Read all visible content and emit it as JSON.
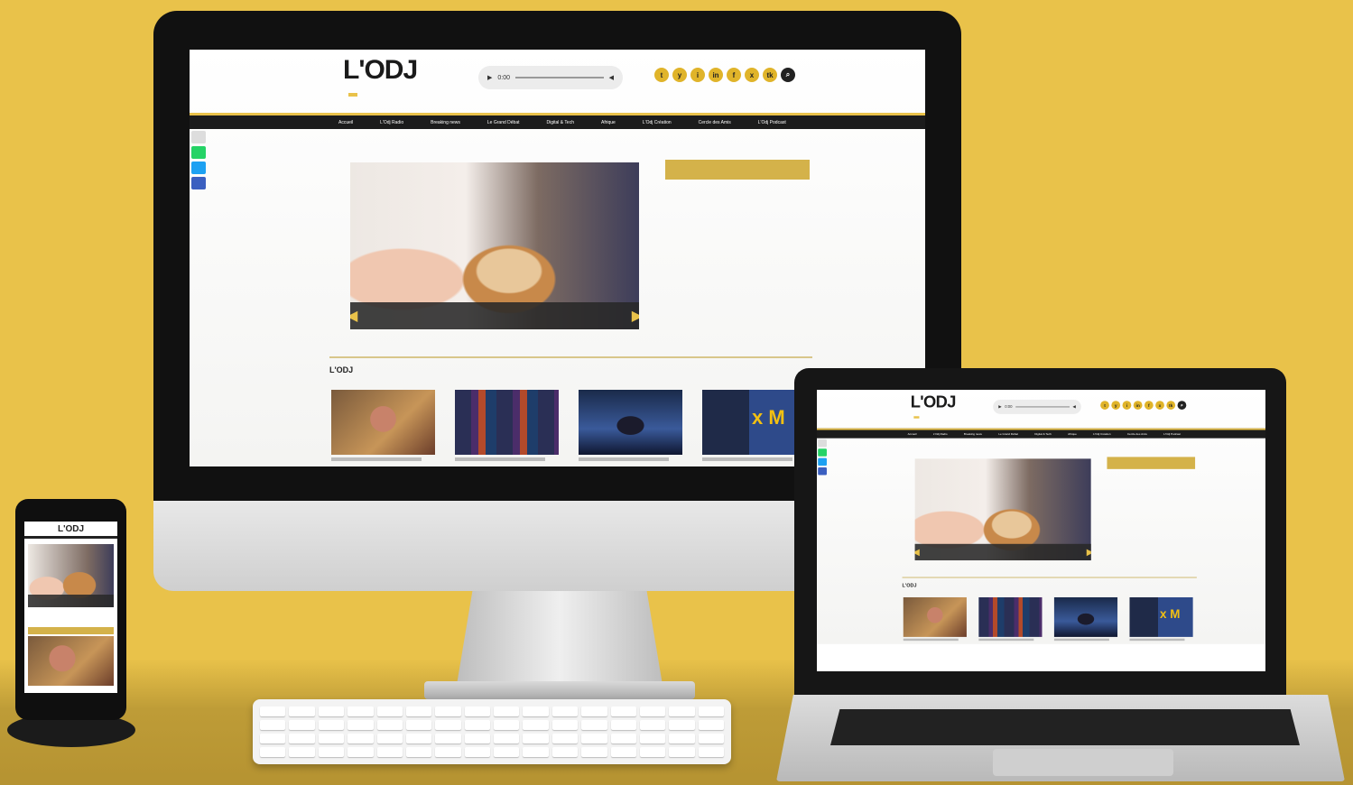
{
  "site": {
    "logo": "L'ODJ",
    "tagline": "",
    "player_time": "0:00",
    "socials": [
      "t",
      "y",
      "i",
      "in",
      "f",
      "x",
      "tk"
    ],
    "nav": [
      "Accueil",
      "L'Odj Radio",
      "Breaking news",
      "Le Grand Débat",
      "Digital & Tech",
      "Afrique",
      "L'Odj Création",
      "Cercle des Amis",
      "L'Odj Podcast"
    ],
    "ticker": [],
    "hero_caption": "",
    "sidebar_title": "",
    "sidebar_items": [],
    "section_title": "L'ODJ",
    "phone_logo": "L'ODJ"
  },
  "colors": {
    "background": "#e9c24a",
    "accent": "#d4b24a",
    "nav": "#1c1c1c"
  }
}
